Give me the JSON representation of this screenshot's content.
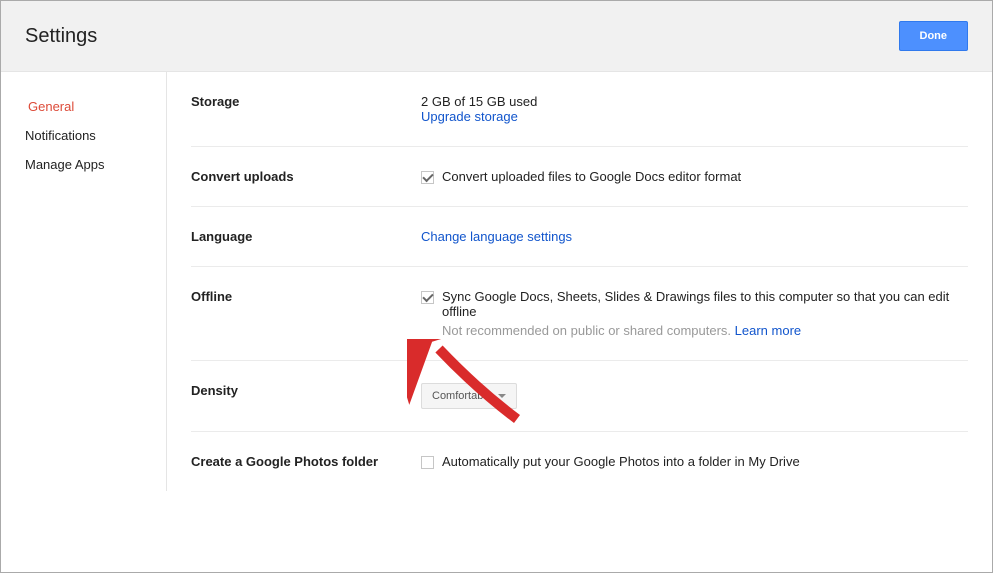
{
  "header": {
    "title": "Settings",
    "done": "Done"
  },
  "sidebar": {
    "items": [
      {
        "label": "General",
        "active": true
      },
      {
        "label": "Notifications",
        "active": false
      },
      {
        "label": "Manage Apps",
        "active": false
      }
    ]
  },
  "rows": {
    "storage": {
      "label": "Storage",
      "usage": "2 GB of 15 GB used",
      "upgrade": "Upgrade storage"
    },
    "convert": {
      "label": "Convert uploads",
      "checkbox_label": "Convert uploaded files to Google Docs editor format",
      "checked": true
    },
    "language": {
      "label": "Language",
      "link": "Change language settings"
    },
    "offline": {
      "label": "Offline",
      "checkbox_label": "Sync Google Docs, Sheets, Slides & Drawings files to this computer so that you can edit offline",
      "checked": true,
      "hint_prefix": "Not recommended on public or shared computers. ",
      "learn_more": "Learn more"
    },
    "density": {
      "label": "Density",
      "value": "Comfortable"
    },
    "photos": {
      "label": "Create a Google Photos folder",
      "checkbox_label": "Automatically put your Google Photos into a folder in My Drive",
      "checked": false
    }
  }
}
